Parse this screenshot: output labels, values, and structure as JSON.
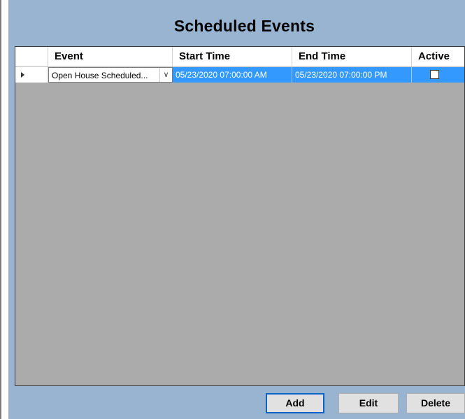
{
  "panel": {
    "title": "Scheduled Events"
  },
  "grid": {
    "columns": [
      "Event",
      "Start Time",
      "End Time",
      "Active"
    ],
    "rows": [
      {
        "event": "Open House Scheduled...",
        "start_time": "05/23/2020 07:00:00 AM",
        "end_time": "05/23/2020 07:00:00 PM",
        "active": false
      }
    ]
  },
  "buttons": {
    "add": "Add",
    "edit": "Edit",
    "delete": "Delete"
  },
  "icons": {
    "row_indicator": "current-row-triangle-icon",
    "dropdown": "chevron-down-icon"
  },
  "colors": {
    "panel_bg": "#99b4d1",
    "grid_bg": "#ababab",
    "selection": "#3399ff",
    "focus_border": "#0a62c7"
  }
}
